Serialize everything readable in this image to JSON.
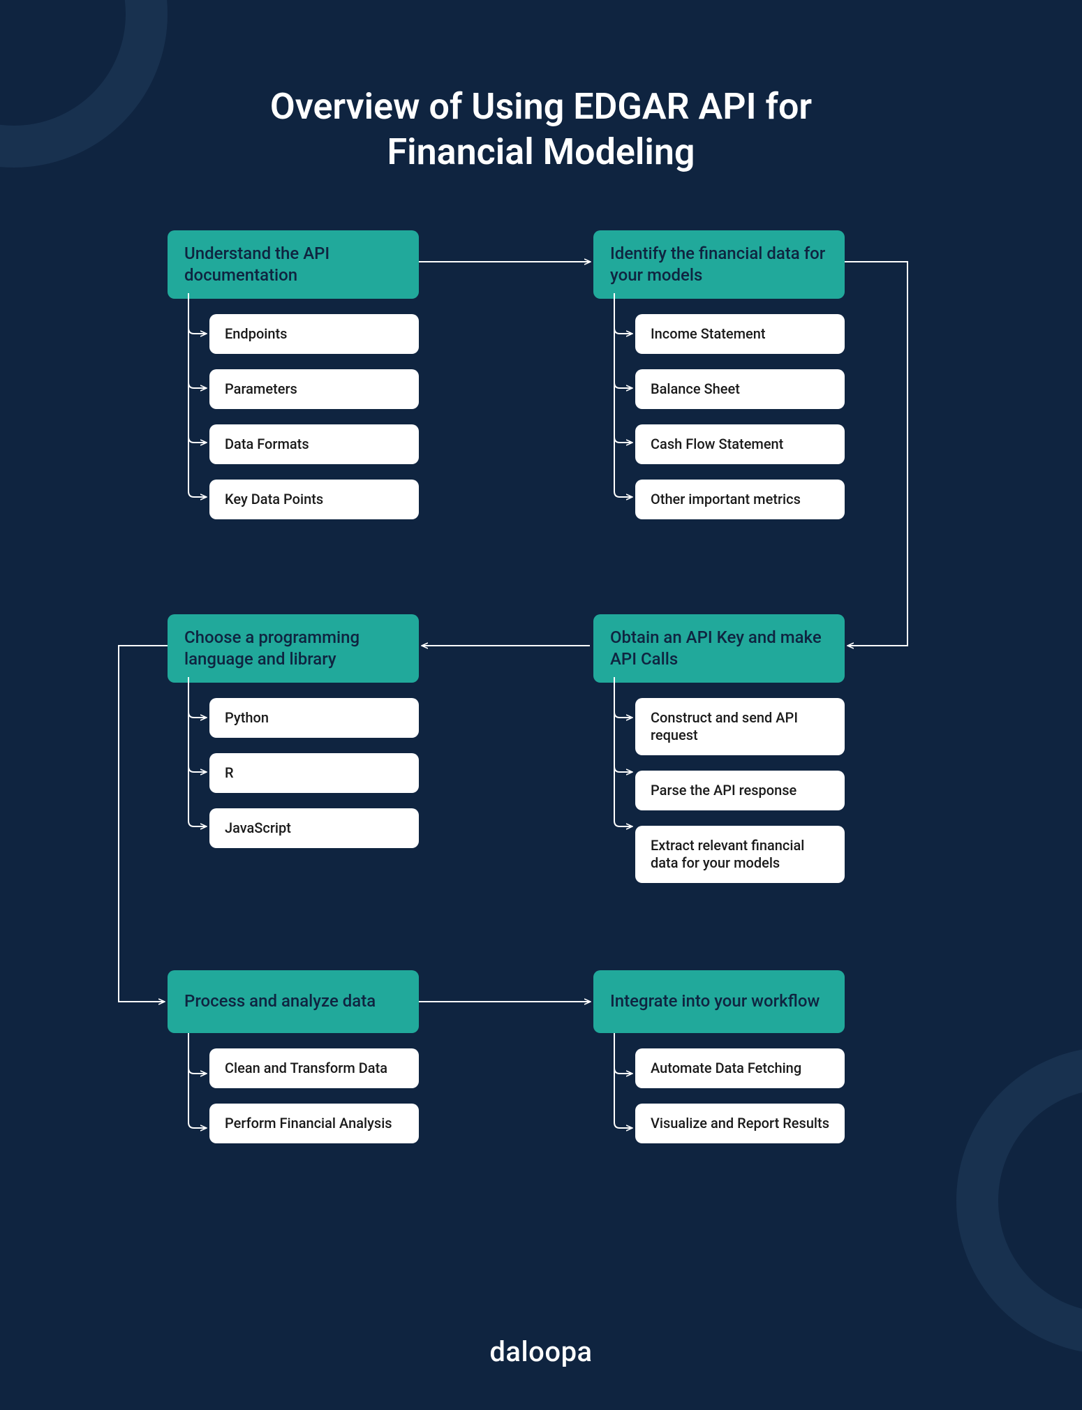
{
  "title_line1": "Overview of Using EDGAR API for",
  "title_line2": "Financial Modeling",
  "brand": "daloopa",
  "steps": {
    "s1": {
      "header": "Understand the API documentation",
      "items": [
        "Endpoints",
        "Parameters",
        "Data Formats",
        "Key Data Points"
      ]
    },
    "s2": {
      "header": "Identify the financial data for your models",
      "items": [
        "Income Statement",
        "Balance Sheet",
        "Cash Flow Statement",
        "Other important metrics"
      ]
    },
    "s3": {
      "header": "Obtain an API Key and make API Calls",
      "items": [
        "Construct and send API request",
        "Parse the API response",
        "Extract relevant financial data for your models"
      ]
    },
    "s4": {
      "header": "Choose a programming language and library",
      "items": [
        "Python",
        "R",
        "JavaScript"
      ]
    },
    "s5": {
      "header": "Process and analyze data",
      "items": [
        "Clean and Transform Data",
        "Perform Financial Analysis"
      ]
    },
    "s6": {
      "header": "Integrate into your workflow",
      "items": [
        "Automate Data Fetching",
        "Visualize and Report Results"
      ]
    }
  }
}
